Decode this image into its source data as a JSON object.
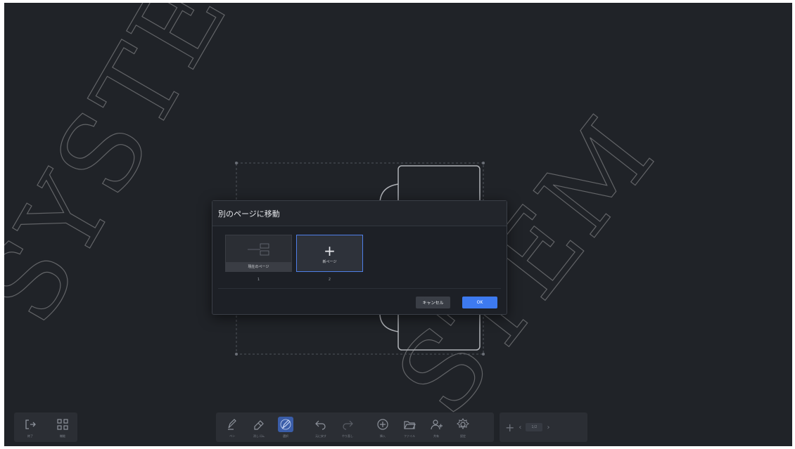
{
  "watermark": {
    "text_left": "SYSTE",
    "text_right": "STEM"
  },
  "dialog": {
    "title": "別のページに移動",
    "pages": [
      {
        "label": "現在のページ",
        "number": "1",
        "selected": false
      },
      {
        "label": "新ページ",
        "number": "2",
        "selected": true,
        "icon": "plus-icon"
      }
    ],
    "cancel_label": "キャンセル",
    "ok_label": "OK",
    "accent_color": "#3d7af0"
  },
  "toolbar": {
    "left": [
      {
        "icon": "exit-icon",
        "label": "終了"
      },
      {
        "icon": "apps-icon",
        "label": "機能"
      }
    ],
    "tools": [
      {
        "icon": "pen-icon",
        "label": "ペン"
      },
      {
        "icon": "eraser-icon",
        "label": "消しゴム"
      },
      {
        "icon": "select-icon",
        "label": "選択",
        "active": true
      },
      {
        "icon": "undo-icon",
        "label": "元に戻す"
      },
      {
        "icon": "redo-icon",
        "label": "やり直し"
      },
      {
        "icon": "insert-icon",
        "label": "挿入"
      },
      {
        "icon": "folder-icon",
        "label": "ファイル"
      },
      {
        "icon": "share-icon",
        "label": "共有"
      },
      {
        "icon": "settings-icon",
        "label": "設定"
      }
    ],
    "pager": {
      "indicator": "1/2"
    }
  }
}
